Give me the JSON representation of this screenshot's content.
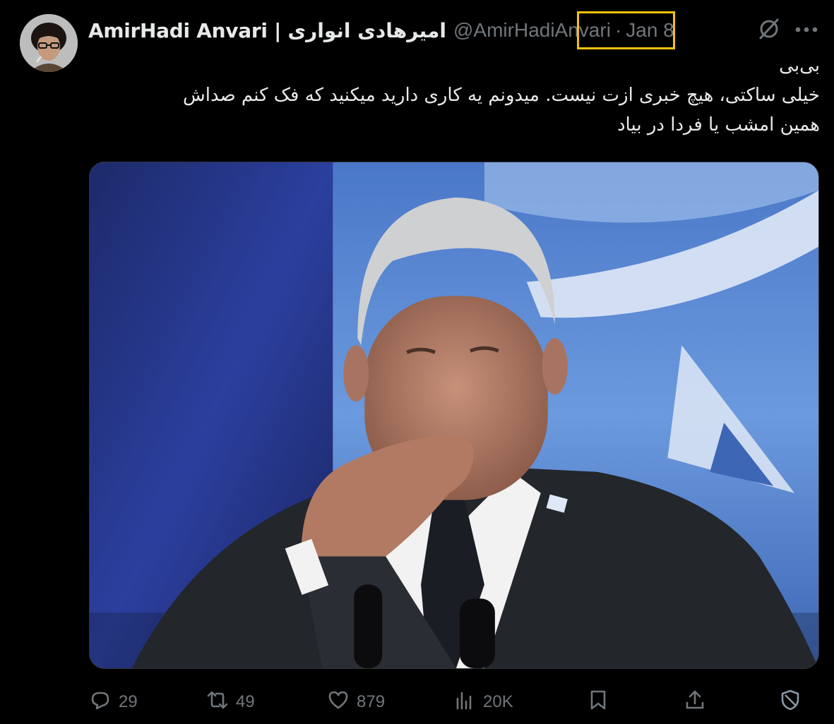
{
  "author": {
    "display_name": "AmirHadi Anvari | امیرهادی انواری",
    "handle": "@AmirHadiAnvari",
    "separator": "·",
    "date": "Jan 8"
  },
  "icons": {
    "grok": "grok-icon",
    "more": "more-horizontal-icon",
    "reply": "reply-icon",
    "repost": "repost-icon",
    "like": "like-icon",
    "views": "views-icon",
    "bookmark": "bookmark-icon",
    "share": "share-icon",
    "block": "block-icon"
  },
  "tweet": {
    "lines": [
      "بی‌بی",
      "خیلی ساکتی، هیچ خبری ازت نیست. میدونم یه کاری دارید میکنید که فک کنم صداش",
      "همین امشب یا فردا در بیاد"
    ]
  },
  "stats": {
    "replies": "29",
    "reposts": "49",
    "likes": "879",
    "views": "20K"
  },
  "colors": {
    "background": "#000000",
    "text": "#e7e9ea",
    "muted": "#71767b",
    "highlight": "#f4c20d"
  }
}
